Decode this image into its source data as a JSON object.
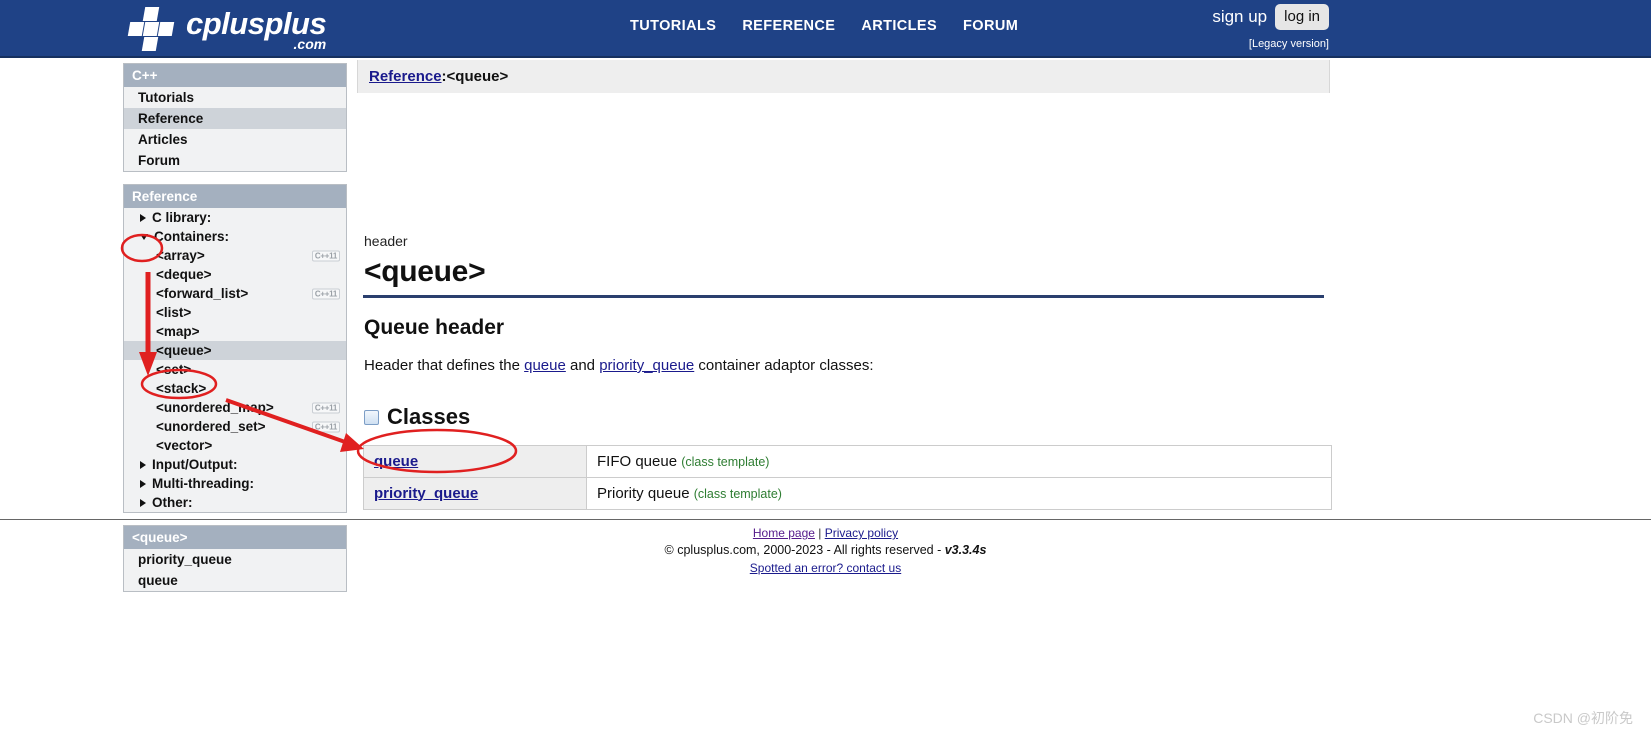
{
  "header": {
    "logo": {
      "name": "cplusplus",
      "suffix": ".com"
    },
    "nav": [
      {
        "label": "TUTORIALS",
        "name": "nav-tutorials"
      },
      {
        "label": "REFERENCE",
        "name": "nav-reference"
      },
      {
        "label": "ARTICLES",
        "name": "nav-articles"
      },
      {
        "label": "FORUM",
        "name": "nav-forum"
      }
    ],
    "sign_up": "sign up",
    "log_in": "log in",
    "legacy": "[Legacy version]"
  },
  "sidebar": {
    "cpp_panel": {
      "title": "C++",
      "items": [
        {
          "label": "Tutorials",
          "selected": false
        },
        {
          "label": "Reference",
          "selected": true
        },
        {
          "label": "Articles",
          "selected": false
        },
        {
          "label": "Forum",
          "selected": false
        }
      ]
    },
    "reference_panel": {
      "title": "Reference",
      "items": [
        {
          "label": "C library:",
          "type": "group",
          "expanded": false,
          "badge": "",
          "selected": false
        },
        {
          "label": "Containers:",
          "type": "group",
          "expanded": true,
          "badge": "",
          "selected": false
        },
        {
          "label": "<array>",
          "type": "child",
          "badge": "C++11",
          "selected": false
        },
        {
          "label": "<deque>",
          "type": "child",
          "badge": "",
          "selected": false
        },
        {
          "label": "<forward_list>",
          "type": "child",
          "badge": "C++11",
          "selected": false
        },
        {
          "label": "<list>",
          "type": "child",
          "badge": "",
          "selected": false
        },
        {
          "label": "<map>",
          "type": "child",
          "badge": "",
          "selected": false
        },
        {
          "label": "<queue>",
          "type": "child",
          "badge": "",
          "selected": true
        },
        {
          "label": "<set>",
          "type": "child",
          "badge": "",
          "selected": false
        },
        {
          "label": "<stack>",
          "type": "child",
          "badge": "",
          "selected": false
        },
        {
          "label": "<unordered_map>",
          "type": "child",
          "badge": "C++11",
          "selected": false
        },
        {
          "label": "<unordered_set>",
          "type": "child",
          "badge": "C++11",
          "selected": false
        },
        {
          "label": "<vector>",
          "type": "child",
          "badge": "",
          "selected": false
        },
        {
          "label": "Input/Output:",
          "type": "group",
          "expanded": false,
          "badge": "",
          "selected": false
        },
        {
          "label": "Multi-threading:",
          "type": "group",
          "expanded": false,
          "badge": "",
          "selected": false
        },
        {
          "label": "Other:",
          "type": "group",
          "expanded": false,
          "badge": "",
          "selected": false
        }
      ]
    },
    "queue_panel": {
      "title": "<queue>",
      "items": [
        {
          "label": "priority_queue"
        },
        {
          "label": "queue"
        }
      ]
    }
  },
  "breadcrumb": {
    "root": "Reference",
    "separator": " : ",
    "current": "<queue>"
  },
  "main": {
    "kind": "header",
    "title": "<queue>",
    "subtitle": "Queue header",
    "lead": {
      "before": "Header that defines the ",
      "link1": "queue",
      "middle": " and ",
      "link2": "priority_queue",
      "after": " container adaptor classes:"
    },
    "classes_heading": "Classes",
    "classes": [
      {
        "name": "queue",
        "desc": "FIFO queue",
        "template": "(class template)"
      },
      {
        "name": "priority_queue",
        "desc": "Priority queue",
        "template": "(class template)"
      }
    ]
  },
  "footer": {
    "home": "Home page",
    "sep": " | ",
    "privacy": "Privacy policy",
    "copyright": "© cplusplus.com, 2000-2023 - All rights reserved - ",
    "version": "v3.3.4s",
    "spotted": "Spotted an error? contact us"
  },
  "watermark": "CSDN @初阶免",
  "colors": {
    "brand_blue": "#1f4286",
    "panel_header": "#a4b0bf",
    "selected_row": "#ced3d9",
    "link": "#1a1a8c",
    "annotation_red": "#e02020",
    "template_green": "#2e7d32"
  }
}
